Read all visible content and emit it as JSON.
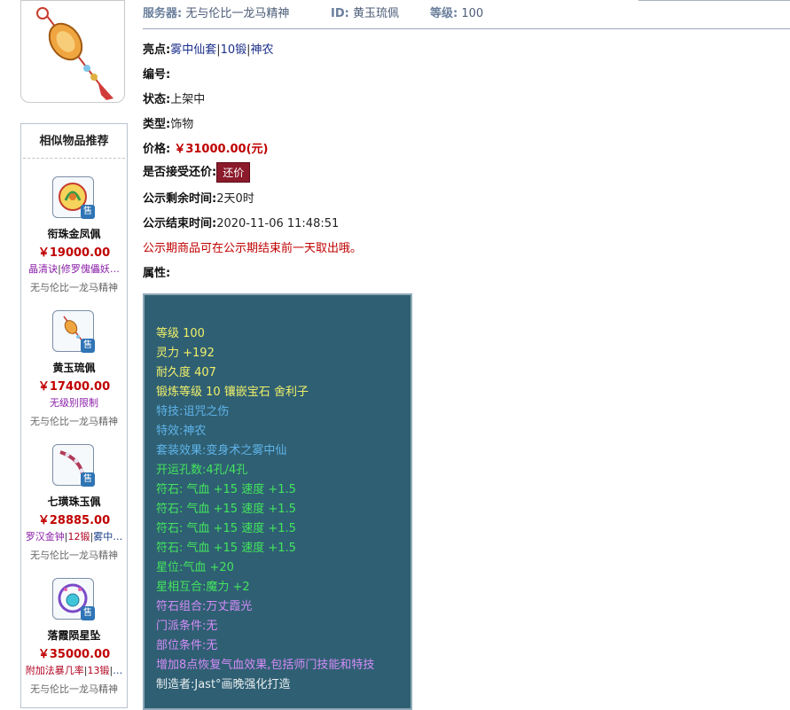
{
  "header": {
    "server_label": "服务器:",
    "server_value": "无与伦比一龙马精神",
    "id_label": "ID:",
    "id_value": "黄玉琉佩",
    "level_label": "等级:",
    "level_value": "100"
  },
  "details": {
    "highlights_label": "亮点:",
    "highlights": [
      "雾中仙套",
      "10锻",
      "神农"
    ],
    "number_label": "编号:",
    "number_value": "",
    "status_label": "状态:",
    "status_value": "上架中",
    "type_label": "类型:",
    "type_value": "饰物",
    "price_label": "价格:",
    "price_value": "￥31000.00(元)",
    "counter_label": "是否接受还价:",
    "counter_button": "还价",
    "remain_label": "公示剩余时间:",
    "remain_value": "2天0时",
    "end_label": "公示结束时间:",
    "end_value": "2020-11-06 11:48:51",
    "notice": "公示期商品可在公示期结束前一天取出哦。",
    "attr_label": "属性:"
  },
  "attributes": [
    {
      "text": "等级 100",
      "color": "yellow"
    },
    {
      "text": "灵力 +192",
      "color": "yellow"
    },
    {
      "text": "耐久度 407",
      "color": "yellow"
    },
    {
      "text": "锻炼等级 10 镶嵌宝石 舍利子",
      "color": "yellow"
    },
    {
      "text": "特技:诅咒之伤",
      "color": "blue"
    },
    {
      "text": "特效:神农",
      "color": "blue"
    },
    {
      "text": "套装效果:变身术之雾中仙",
      "color": "blue"
    },
    {
      "text": "开运孔数:4孔/4孔",
      "color": "green"
    },
    {
      "text": "符石: 气血 +15 速度 +1.5",
      "color": "green"
    },
    {
      "text": "符石: 气血 +15 速度 +1.5",
      "color": "green"
    },
    {
      "text": "符石: 气血 +15 速度 +1.5",
      "color": "green"
    },
    {
      "text": "符石: 气血 +15 速度 +1.5",
      "color": "green"
    },
    {
      "text": "星位:气血 +20",
      "color": "green"
    },
    {
      "text": "星相互合:魔力 +2",
      "color": "green"
    },
    {
      "text": "符石组合:万丈霞光",
      "color": "purple"
    },
    {
      "text": "门派条件:无",
      "color": "purple"
    },
    {
      "text": "部位条件:无",
      "color": "purple"
    },
    {
      "text": "增加8点恢复气血效果,包括师门技能和特技",
      "color": "purple"
    },
    {
      "text": "制造者:Jast°画晚强化打造",
      "color": "white"
    }
  ],
  "sidebar": {
    "title": "相似物品推荐",
    "sale_badge": "售",
    "items": [
      {
        "name": "衔珠金凤佩",
        "price": "￥19000.00",
        "tags": [
          "晶清诀",
          "修罗傀儡妖…"
        ],
        "server": "无与伦比一龙马精神"
      },
      {
        "name": "黄玉琉佩",
        "price": "￥17400.00",
        "tags": [
          "无级别限制"
        ],
        "server": "无与伦比一龙马精神"
      },
      {
        "name": "七璜珠玉佩",
        "price": "￥28885.00",
        "tags": [
          "罗汉金钟",
          "12锻",
          "雾中…"
        ],
        "server": "无与伦比一龙马精神"
      },
      {
        "name": "落霞陨星坠",
        "price": "￥35000.00",
        "tags": [
          "附加法暴几率",
          "13锻",
          "…"
        ],
        "server": "无与伦比一龙马精神"
      }
    ]
  },
  "colors": {
    "price_red": "#c00000",
    "attr_bg": "#2f5f73",
    "button_bg": "#8b1a2b"
  }
}
